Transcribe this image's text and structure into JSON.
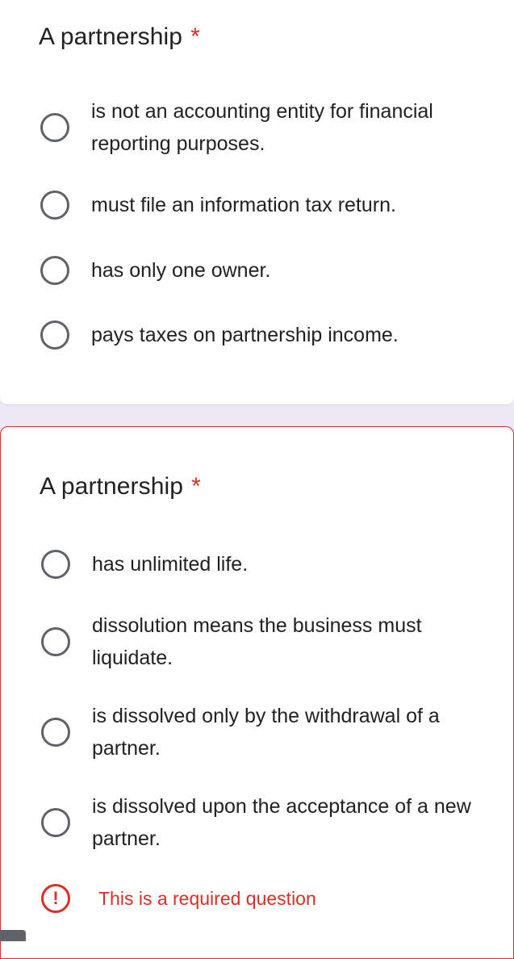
{
  "questions": [
    {
      "title": "A partnership",
      "required_mark": "*",
      "options": [
        {
          "label": "is not an accounting entity for financial reporting purposes."
        },
        {
          "label": "must file an information tax return."
        },
        {
          "label": "has only one owner."
        },
        {
          "label": "pays taxes on partnership income."
        }
      ]
    },
    {
      "title": "A partnership",
      "required_mark": "*",
      "options": [
        {
          "label": "has unlimited life."
        },
        {
          "label": "dissolution means the business must liquidate."
        },
        {
          "label": "is dissolved only by the withdrawal of a partner."
        },
        {
          "label": "is dissolved upon the acceptance of a new partner."
        }
      ],
      "error": {
        "icon": "!",
        "text": "This is a required question"
      }
    }
  ],
  "colors": {
    "background": "#ede7f6",
    "error": "#d93025",
    "radio_border": "#5f6368"
  }
}
